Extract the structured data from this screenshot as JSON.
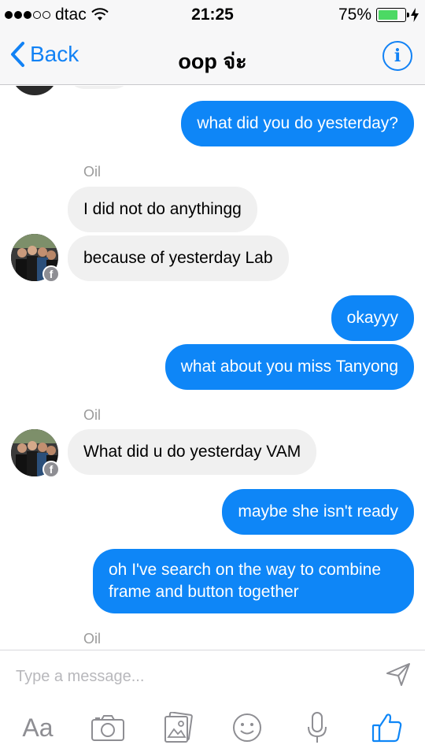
{
  "status_bar": {
    "carrier": "dtac",
    "time": "21:25",
    "battery_percent": "75%",
    "battery_level": 0.75,
    "signal_dots_filled": 3,
    "signal_dots_total": 5
  },
  "nav": {
    "back_label": "Back",
    "title": "oop จ่ะ",
    "info_icon": "info-icon"
  },
  "messages": [
    {
      "type": "outgoing",
      "text": "what did you do yesterday?"
    },
    {
      "type": "sender",
      "text": "Oil"
    },
    {
      "type": "incoming",
      "text": "I did not do anythingg"
    },
    {
      "type": "incoming",
      "text": "because of yesterday Lab"
    },
    {
      "type": "outgoing",
      "text": "okayyy"
    },
    {
      "type": "outgoing",
      "text": "what about you miss Tanyong"
    },
    {
      "type": "sender",
      "text": "Oil"
    },
    {
      "type": "incoming",
      "text": "What did u do yesterday VAM"
    },
    {
      "type": "outgoing",
      "text": "maybe she isn't ready"
    },
    {
      "type": "outgoing",
      "text": "oh I've search on the way to combine frame and button together"
    },
    {
      "type": "sender",
      "text": "Oil"
    }
  ],
  "composer": {
    "placeholder": "Type a message...",
    "tools": [
      "text-format-icon",
      "camera-icon",
      "photo-gallery-icon",
      "emoji-icon",
      "microphone-icon",
      "like-icon"
    ],
    "aa_label": "Aa"
  },
  "colors": {
    "accent": "#0e86f7",
    "incoming_bubble": "#f0f0f0",
    "secondary_text": "#9b9b9b"
  }
}
